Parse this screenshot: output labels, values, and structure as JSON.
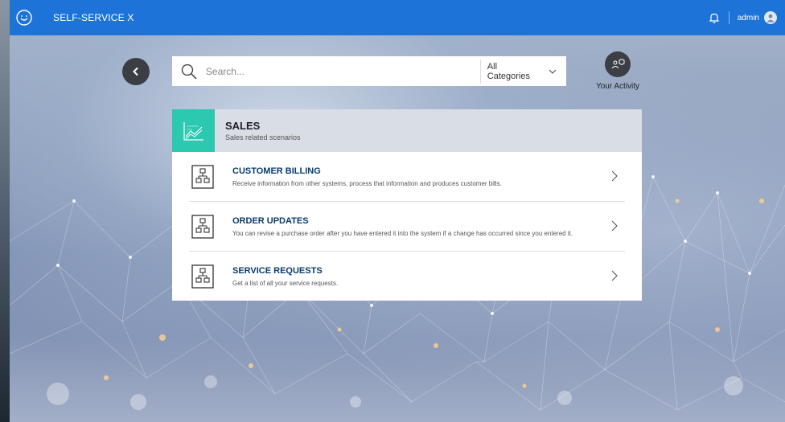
{
  "app": {
    "title": "SELF-SERVICE X"
  },
  "header": {
    "user": "admin"
  },
  "search": {
    "placeholder": "Search...",
    "category": "All Categories"
  },
  "activity": {
    "label": "Your Activity"
  },
  "section": {
    "title": "SALES",
    "subtitle": "Sales related scenarios"
  },
  "items": [
    {
      "title": "CUSTOMER BILLING",
      "description": "Receive information from other systems, process that information and produces customer bills."
    },
    {
      "title": "ORDER UPDATES",
      "description": "You can revise a purchase order after you have entered it into the system if a change has occurred since you entered it."
    },
    {
      "title": "SERVICE REQUESTS",
      "description": "Get a list of all your service requests."
    }
  ],
  "colors": {
    "topbar": "#1e73d8",
    "accent": "#2dc8b0",
    "title_blue": "#0a3b6b"
  },
  "icons": {
    "logo": "chat-bubble-icon",
    "bell": "bell-icon",
    "avatar": "user-icon",
    "back": "chevron-left-icon",
    "search": "search-icon",
    "dropdown": "chevron-down-icon",
    "activity": "activity-icon",
    "section": "line-chart-icon",
    "item": "flowchart-icon",
    "item_arrow": "chevron-right-icon"
  }
}
